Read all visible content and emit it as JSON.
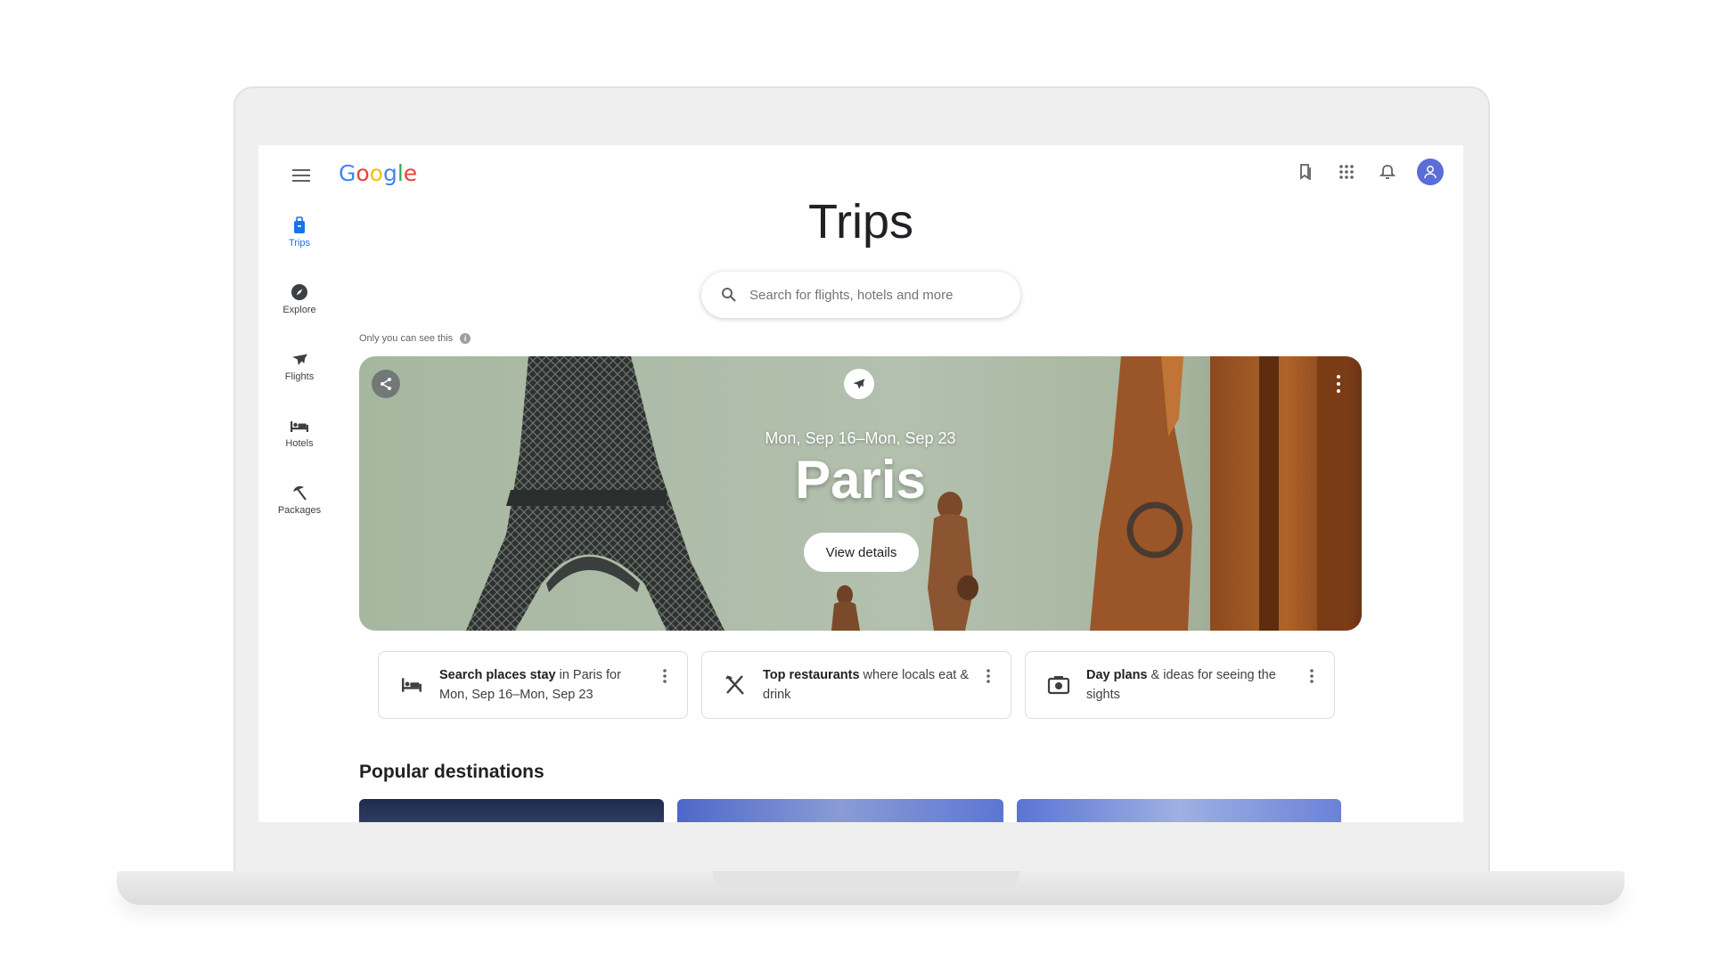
{
  "header": {
    "logo_letters": [
      "G",
      "o",
      "o",
      "g",
      "l",
      "e"
    ]
  },
  "nav": {
    "items": [
      {
        "label": "Trips"
      },
      {
        "label": "Explore"
      },
      {
        "label": "Flights"
      },
      {
        "label": "Hotels"
      },
      {
        "label": "Packages"
      }
    ]
  },
  "main": {
    "title": "Trips",
    "search_placeholder": "Search for flights, hotels and more",
    "private_note": "Only you can see this"
  },
  "trip": {
    "dates": "Mon, Sep 16–Mon, Sep 23",
    "city": "Paris",
    "view_details_label": "View details"
  },
  "cards": [
    {
      "bold": "Search places stay",
      "rest": " in Paris for Mon, Sep 16–Mon, Sep 23",
      "icon": "hotel-bed-icon"
    },
    {
      "bold": "Top restaurants",
      "rest": " where locals eat & drink",
      "icon": "restaurant-icon"
    },
    {
      "bold": "Day plans",
      "rest": " & ideas for seeing the sights",
      "icon": "camera-icon"
    }
  ],
  "popular": {
    "title": "Popular destinations"
  },
  "colors": {
    "accent": "#1a73e8",
    "avatar": "#5b6ed6",
    "hero_sky": "#9fb49a"
  }
}
